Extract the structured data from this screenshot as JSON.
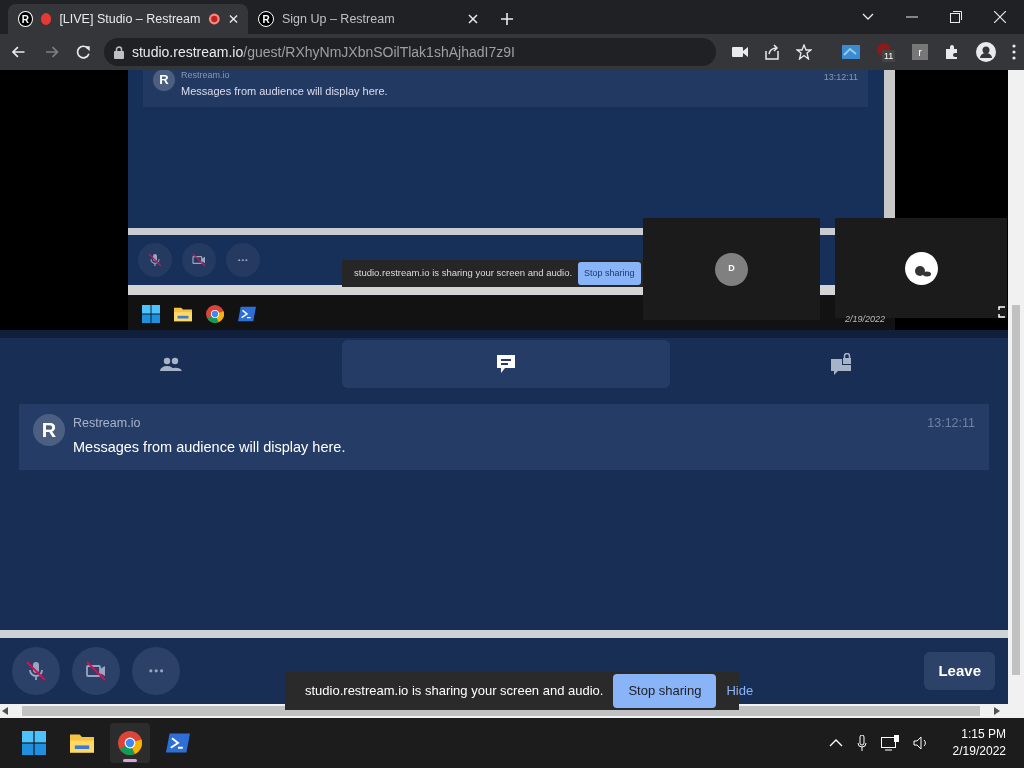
{
  "browser": {
    "tabs": [
      {
        "favicon": "R",
        "title": "[LIVE] Studio – Restream",
        "selected": true,
        "recording": true
      },
      {
        "favicon": "R",
        "title": "Sign Up – Restream",
        "selected": false,
        "recording": false
      }
    ],
    "url": {
      "host": "studio.restream.io",
      "path": "/guest/RXhyNmJXbnSOilTlak1shAjhadI7z9I"
    },
    "extension_badge": "11",
    "extension_letter": "r"
  },
  "shared_screen": {
    "message": {
      "avatar": "R",
      "author": "Restream.io",
      "text": "Messages from audience will display here.",
      "time": "13:12:11"
    },
    "share_bar": {
      "text": "studio.restream.io is sharing your screen and audio.",
      "button": "Stop sharing"
    },
    "date": "2/19/2022"
  },
  "participants": [
    {
      "kind": "initial",
      "initial": "D"
    },
    {
      "kind": "avatar"
    }
  ],
  "chat_tabs": [
    {
      "kind": "people",
      "selected": false
    },
    {
      "kind": "chat",
      "selected": true
    },
    {
      "kind": "private",
      "selected": false
    }
  ],
  "messages": [
    {
      "avatar": "R",
      "author": "Restream.io",
      "text": "Messages from audience will display here.",
      "time": "13:12:11"
    }
  ],
  "controls": [
    {
      "kind": "mic",
      "off": true
    },
    {
      "kind": "camera",
      "off": true
    },
    {
      "kind": "more"
    }
  ],
  "leave": "Leave",
  "share_bar": {
    "text": "studio.restream.io is sharing your screen and audio.",
    "stop": "Stop sharing",
    "hide": "Hide"
  },
  "taskbar": {
    "apps": [
      {
        "kind": "start",
        "selected": false
      },
      {
        "kind": "folder",
        "selected": false
      },
      {
        "kind": "browser",
        "selected": true
      },
      {
        "kind": "terminal",
        "selected": false
      }
    ],
    "time": "1:15 PM",
    "date": "2/19/2022"
  }
}
